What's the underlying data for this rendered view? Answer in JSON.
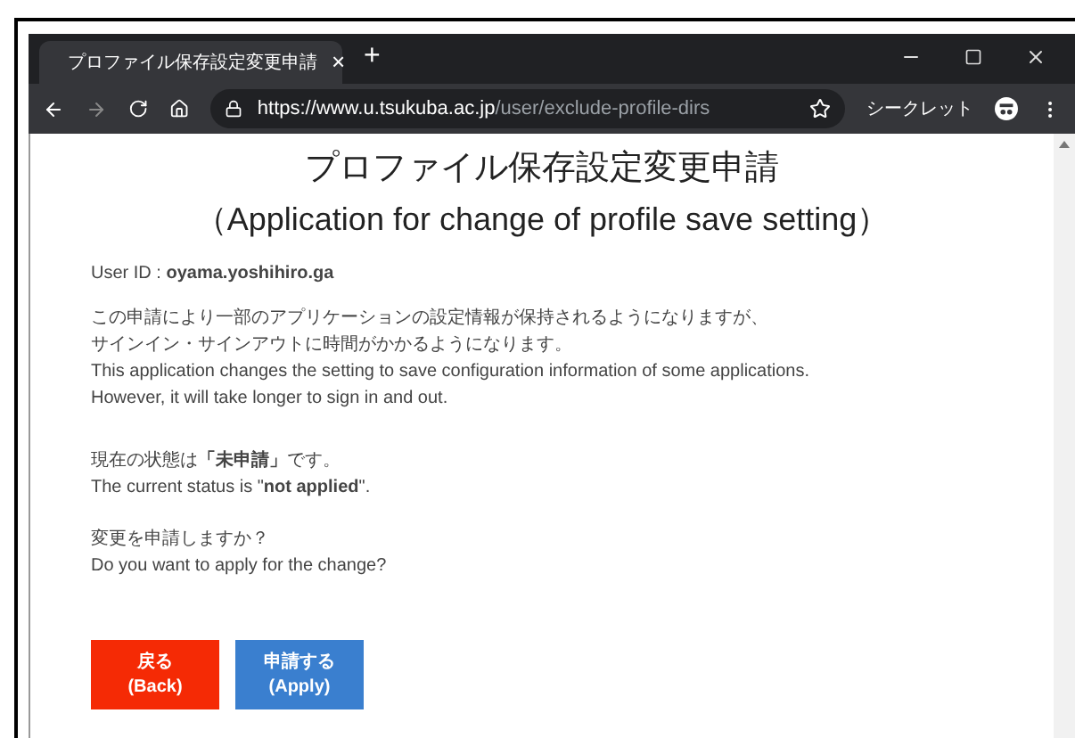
{
  "browser": {
    "tab": {
      "title": "プロファイル保存設定変更申請",
      "close": "×"
    },
    "new_tab": "+",
    "url_host": "https://www.u.tsukuba.ac.jp",
    "url_path": "/user/exclude-profile-dirs",
    "incognito": "シークレット"
  },
  "page": {
    "title": "プロファイル保存設定変更申請",
    "subtitle": "（Application for change of profile save setting）",
    "user_id": "User ID : **oyama.yoshihiro.ga**",
    "notes": [
      "この申請により一部のアプリケーションの設定情報が保持されるようになりますが、",
      "サインイン・サインアウトに時間がかかるようになります。",
      "This application changes the setting to save configuration information of some applications.",
      "However, it will take longer to sign in and out."
    ],
    "status": [
      "現在の状態は**「未申請」**です。",
      "The current status is \"**not applied**\"."
    ],
    "question": [
      "変更を申請しますか？",
      "Do you want to apply for the change?"
    ],
    "buttons": [
      {
        "kind": "back",
        "label": "戻る",
        "sub": "(Back)"
      },
      {
        "kind": "apply",
        "label": "申請する",
        "sub": "(Apply)"
      }
    ]
  }
}
